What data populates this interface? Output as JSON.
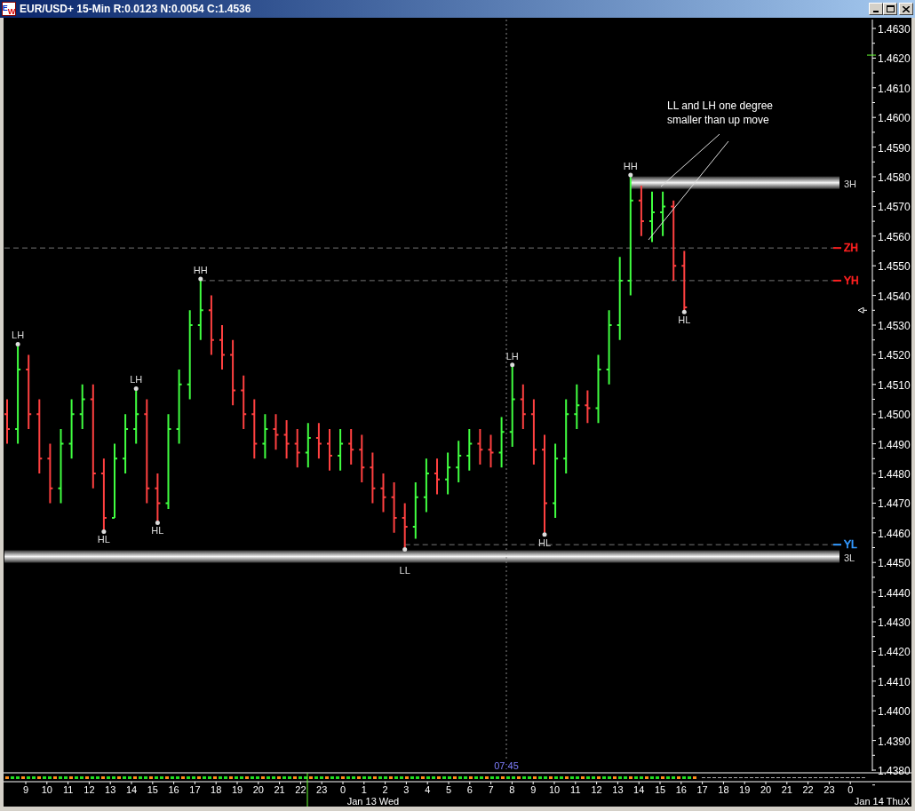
{
  "window": {
    "title": "EUR/USD+ 15-Min R:0.0123 N:0.0054 C:1.4536",
    "logo": [
      "E",
      "W"
    ]
  },
  "chart": {
    "note_lines": [
      "LL and LH one degree",
      "smaller than up move"
    ],
    "crosshair_time": "07:45",
    "pivots": [
      {
        "text": "LH"
      },
      {
        "text": "HL"
      },
      {
        "text": "LH"
      },
      {
        "text": "HL"
      },
      {
        "text": "HH"
      },
      {
        "text": "LL"
      },
      {
        "text": "LH"
      },
      {
        "text": "HL"
      },
      {
        "text": "HH"
      },
      {
        "text": "HL"
      }
    ],
    "levels": [
      {
        "kind": "band",
        "text": "3H"
      },
      {
        "kind": "line",
        "text": "ZH",
        "color": "#ff2020"
      },
      {
        "kind": "line",
        "text": "YH",
        "color": "#ff2020"
      },
      {
        "kind": "line",
        "text": "YL",
        "color": "#3399ff"
      },
      {
        "kind": "band",
        "text": "3L"
      }
    ],
    "price_axis": [
      "1.4630",
      "1.4620",
      "1.4610",
      "1.4600",
      "1.4590",
      "1.4580",
      "1.4570",
      "1.4560",
      "1.4550",
      "1.4540",
      "1.4530",
      "1.4520",
      "1.4510",
      "1.4500",
      "1.4490",
      "1.4480",
      "1.4470",
      "1.4460",
      "1.4450",
      "1.4440",
      "1.4430",
      "1.4420",
      "1.4410",
      "1.4400",
      "1.4390",
      "1.4380"
    ],
    "time_axis": [
      "9",
      "10",
      "11",
      "12",
      "13",
      "14",
      "15",
      "16",
      "17",
      "18",
      "19",
      "20",
      "21",
      "22",
      "23",
      "0",
      "1",
      "2",
      "3",
      "4",
      "5",
      "6",
      "7",
      "8",
      "9",
      "10",
      "11",
      "12",
      "13",
      "14",
      "15",
      "16",
      "17",
      "18",
      "19",
      "20",
      "21",
      "22",
      "23",
      "0"
    ],
    "dates": [
      "Jan 13 Wed",
      "Jan 14 ThuX"
    ]
  }
}
